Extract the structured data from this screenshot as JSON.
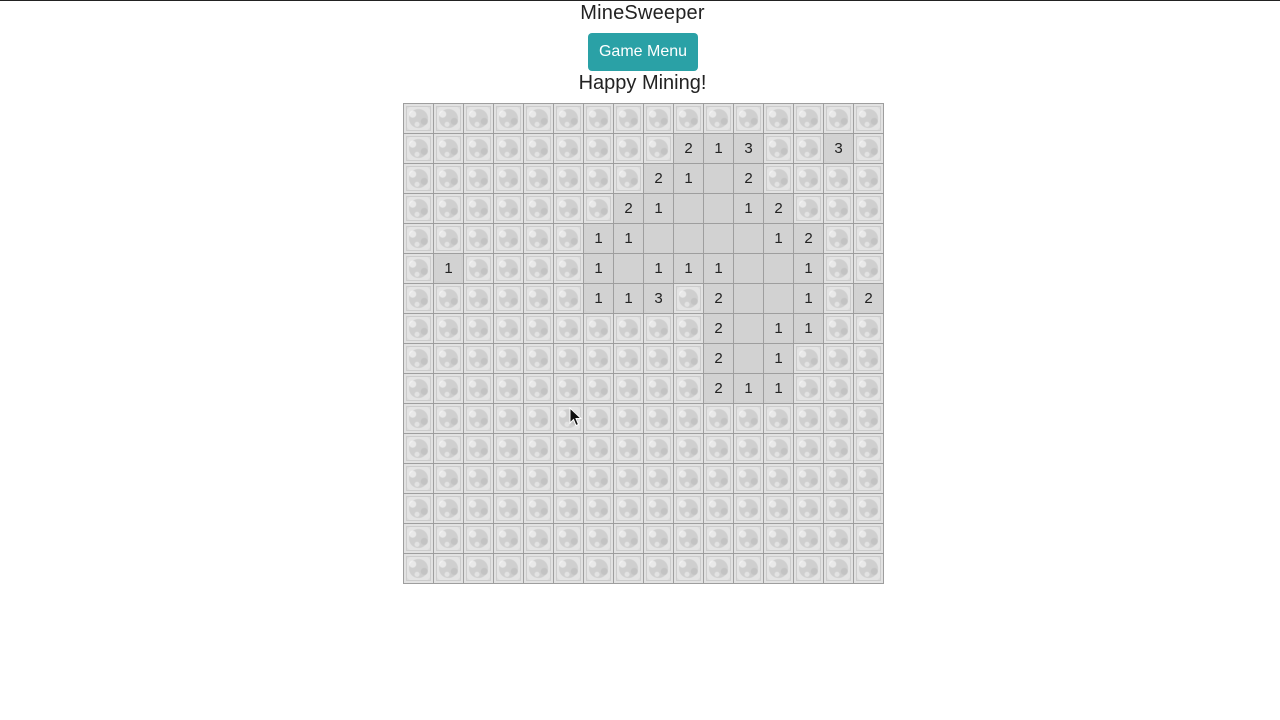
{
  "app": {
    "title": "MineSweeper",
    "menu_button_label": "Game Menu",
    "status_text": "Happy Mining!"
  },
  "colors": {
    "accent": "#2aa1a6",
    "text": "#222222",
    "grid_line": "#9e9e9e",
    "revealed_cell": "#d2d2d2",
    "hidden_cell": "#d6d6d6"
  },
  "board": {
    "rows": 16,
    "cols": 16,
    "cells": [
      [
        "h",
        "h",
        "h",
        "h",
        "h",
        "h",
        "h",
        "h",
        "h",
        "h",
        "h",
        "h",
        "h",
        "h",
        "h",
        "h"
      ],
      [
        "h",
        "h",
        "h",
        "h",
        "h",
        "h",
        "h",
        "h",
        "h",
        "2",
        "1",
        "3",
        "h",
        "h",
        "3",
        "h"
      ],
      [
        "h",
        "h",
        "h",
        "h",
        "h",
        "h",
        "h",
        "h",
        "2",
        "1",
        "",
        "2",
        "h",
        "h",
        "h",
        "h"
      ],
      [
        "h",
        "h",
        "h",
        "h",
        "h",
        "h",
        "h",
        "2",
        "1",
        "",
        "",
        "1",
        "2",
        "h",
        "h",
        "h"
      ],
      [
        "h",
        "h",
        "h",
        "h",
        "h",
        "h",
        "1",
        "1",
        "",
        "",
        "",
        "",
        "1",
        "2",
        "h",
        "h"
      ],
      [
        "h",
        "1",
        "h",
        "h",
        "h",
        "h",
        "1",
        "",
        "1",
        "1",
        "1",
        "",
        "",
        "1",
        "h",
        "h"
      ],
      [
        "h",
        "h",
        "h",
        "h",
        "h",
        "h",
        "1",
        "1",
        "3",
        "h",
        "2",
        "",
        "",
        "1",
        "h",
        "2"
      ],
      [
        "h",
        "h",
        "h",
        "h",
        "h",
        "h",
        "h",
        "h",
        "h",
        "h",
        "2",
        "",
        "1",
        "1",
        "h",
        "h"
      ],
      [
        "h",
        "h",
        "h",
        "h",
        "h",
        "h",
        "h",
        "h",
        "h",
        "h",
        "2",
        "",
        "1",
        "h",
        "h",
        "h"
      ],
      [
        "h",
        "h",
        "h",
        "h",
        "h",
        "h",
        "h",
        "h",
        "h",
        "h",
        "2",
        "1",
        "1",
        "h",
        "h",
        "h"
      ],
      [
        "h",
        "h",
        "h",
        "h",
        "h",
        "h",
        "h",
        "h",
        "h",
        "h",
        "h",
        "h",
        "h",
        "h",
        "h",
        "h"
      ],
      [
        "h",
        "h",
        "h",
        "h",
        "h",
        "h",
        "h",
        "h",
        "h",
        "h",
        "h",
        "h",
        "h",
        "h",
        "h",
        "h"
      ],
      [
        "h",
        "h",
        "h",
        "h",
        "h",
        "h",
        "h",
        "h",
        "h",
        "h",
        "h",
        "h",
        "h",
        "h",
        "h",
        "h"
      ],
      [
        "h",
        "h",
        "h",
        "h",
        "h",
        "h",
        "h",
        "h",
        "h",
        "h",
        "h",
        "h",
        "h",
        "h",
        "h",
        "h"
      ],
      [
        "h",
        "h",
        "h",
        "h",
        "h",
        "h",
        "h",
        "h",
        "h",
        "h",
        "h",
        "h",
        "h",
        "h",
        "h",
        "h"
      ],
      [
        "h",
        "h",
        "h",
        "h",
        "h",
        "h",
        "h",
        "h",
        "h",
        "h",
        "h",
        "h",
        "h",
        "h",
        "h",
        "h"
      ]
    ]
  },
  "cursor_icon": "mouse-pointer-icon"
}
